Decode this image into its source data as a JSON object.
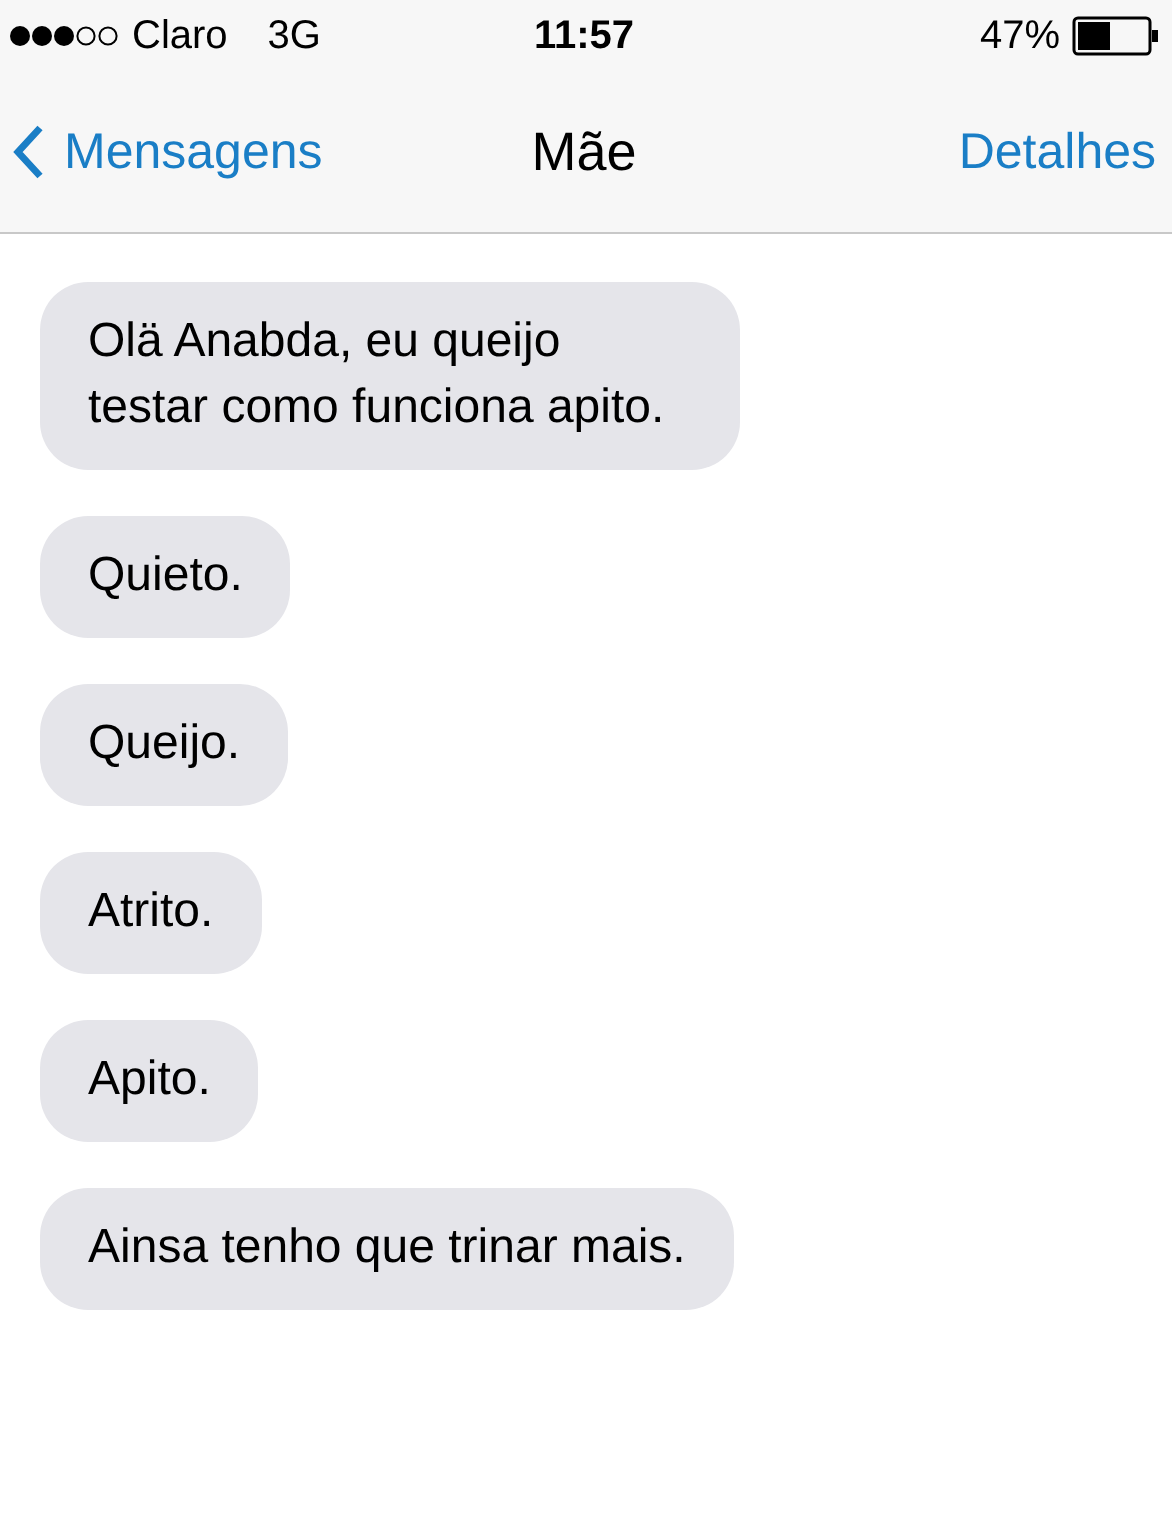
{
  "status_bar": {
    "carrier": "Claro",
    "network": "3G",
    "time": "11:57",
    "battery": "47%"
  },
  "nav_bar": {
    "back": "Mensagens",
    "title": "Mãe",
    "action": "Detalhes"
  },
  "messages": [
    {
      "text": "Olä Anabda, eu queijo testar como funciona apito."
    },
    {
      "text": "Quieto."
    },
    {
      "text": "Queijo."
    },
    {
      "text": "Atrito."
    },
    {
      "text": "Apito."
    },
    {
      "text": "Ainsa tenho que trinar mais."
    }
  ]
}
